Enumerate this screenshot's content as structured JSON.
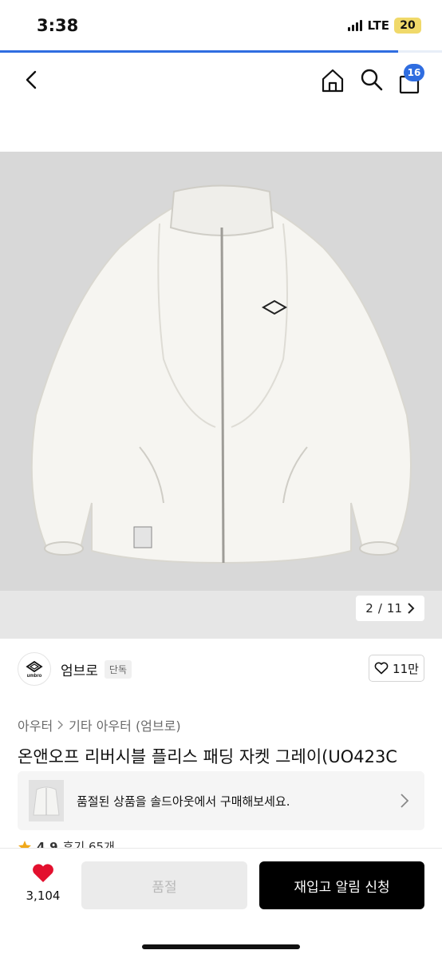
{
  "status_bar": {
    "time": "3:38",
    "network": "LTE",
    "battery": "20",
    "page_load_progress": 0.9
  },
  "header": {
    "back_icon": "chevron-left-icon",
    "home_icon": "home-icon",
    "search_icon": "search-icon",
    "cart_icon": "shopping-bag-icon",
    "cart_count": "16"
  },
  "gallery": {
    "current": "2",
    "separator": "/",
    "total": "11",
    "next_icon": "chevron-right-icon",
    "background_color": "#d8d8d8"
  },
  "brand": {
    "name": "엄브로",
    "tag": "단독",
    "logo_text": "umbro",
    "like_count": "11만"
  },
  "breadcrumb": {
    "level1": "아우터",
    "level2": "기타 아우터 (엄브로)"
  },
  "product": {
    "title": "온앤오프 리버시블 플리스 패딩 자켓 그레이(UO423C"
  },
  "soldout_banner": {
    "text": "품절된 상품을 솔드아웃에서 구매해보세요."
  },
  "rating": {
    "score": "4.9",
    "reviews": "후기 65개"
  },
  "bottom_bar": {
    "wish_count": "3,104",
    "soldout_label": "품절",
    "restock_label": "재입고 알림 신청"
  },
  "colors": {
    "accent": "#2f6de0",
    "heart": "#e3102e",
    "primary_button": "#000000",
    "disabled_button": "#ebebeb"
  }
}
